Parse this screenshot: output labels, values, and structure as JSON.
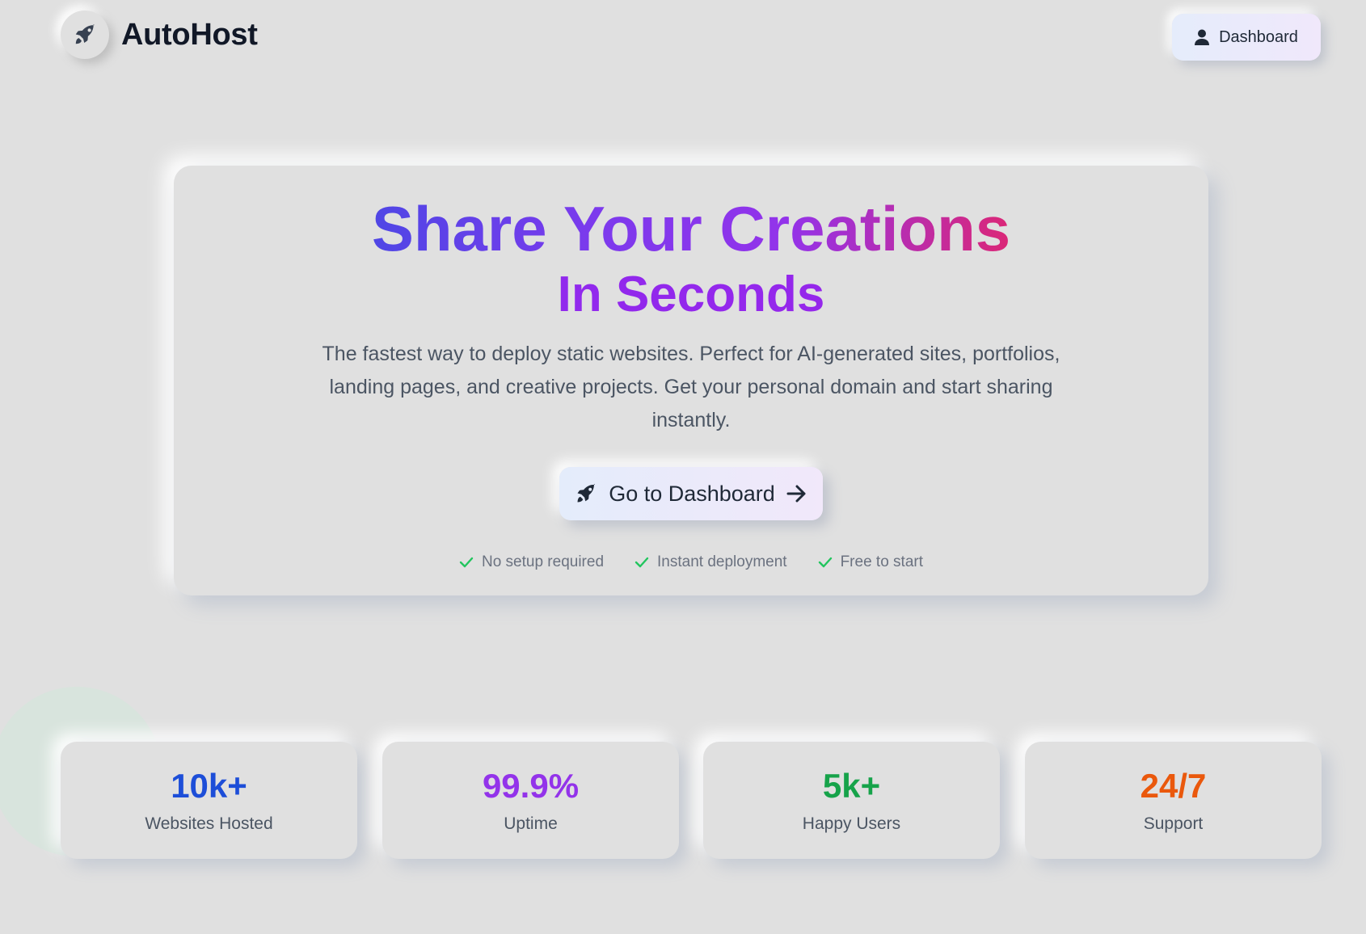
{
  "header": {
    "brand": "AutoHost",
    "logo_icon": "rocket-icon",
    "dashboard_button": {
      "label": "Dashboard",
      "icon": "user-icon"
    }
  },
  "hero": {
    "title": "Share Your Creations",
    "subtitle": "In Seconds",
    "description": "The fastest way to deploy static websites. Perfect for AI-generated sites, portfolios, landing pages, and creative projects. Get your personal domain and start sharing instantly.",
    "cta": {
      "label": "Go to Dashboard",
      "icon_left": "rocket-icon",
      "icon_right": "arrow-right-icon"
    },
    "features": [
      {
        "label": "No setup required",
        "icon": "check-icon"
      },
      {
        "label": "Instant deployment",
        "icon": "check-icon"
      },
      {
        "label": "Free to start",
        "icon": "check-icon"
      }
    ]
  },
  "stats": [
    {
      "value": "10k+",
      "label": "Websites Hosted",
      "color": "#1d4ed8"
    },
    {
      "value": "99.9%",
      "label": "Uptime",
      "color": "#9333ea"
    },
    {
      "value": "5k+",
      "label": "Happy Users",
      "color": "#16a34a"
    },
    {
      "value": "24/7",
      "label": "Support",
      "color": "#ea580c"
    }
  ],
  "colors": {
    "background": "#e0e0e0",
    "check": "#22c55e",
    "gradient_start": "#4f46e5",
    "gradient_mid": "#9333ea",
    "gradient_end": "#db2777"
  }
}
